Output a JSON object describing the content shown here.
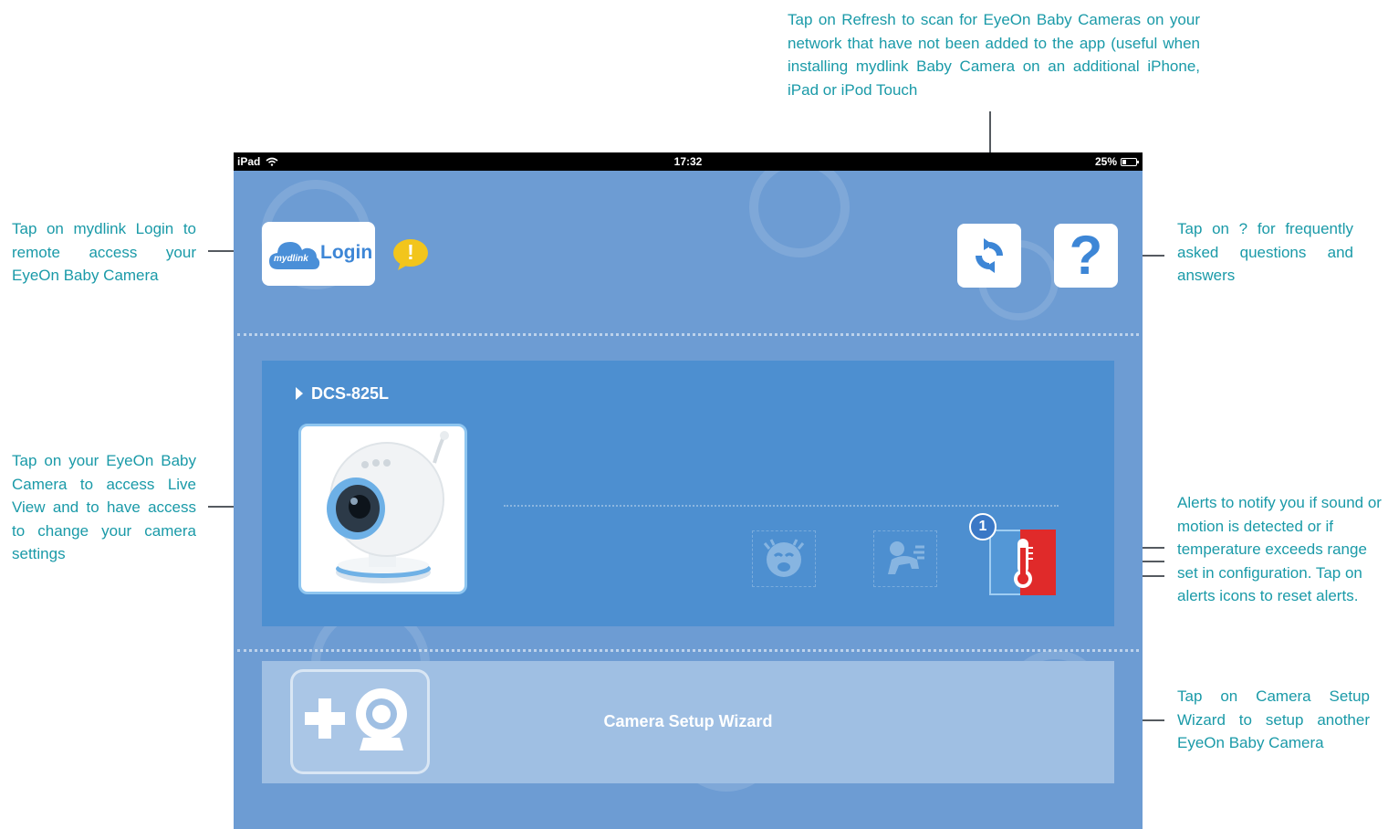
{
  "annotations": {
    "refresh": "Tap on Refresh to scan for EyeOn Baby Cameras on your network that have not been added to the app (useful when installing mydlink Baby Camera on an additional iPhone, iPad or iPod Touch",
    "login": "Tap on mydlink Login to remote access your EyeOn Baby Camera",
    "help": "Tap on ? for frequently asked questions and answers",
    "camera": "Tap on your EyeOn Baby Camera to access Live View and to have access to change your camera settings",
    "alerts": "Alerts to notify you if sound or motion is detected or if temperature exceeds range set in configuration. Tap on alerts icons to reset alerts.",
    "wizard": "Tap on Camera Setup Wizard to setup another EyeOn Baby Camera"
  },
  "status_bar": {
    "device": "iPad",
    "time": "17:32",
    "battery": "25%"
  },
  "header": {
    "login_label": "Login",
    "mydlink_label": "mydlink",
    "warning_mark": "!",
    "help_mark": "?"
  },
  "camera": {
    "name": "DCS-825L",
    "alert_count": "1"
  },
  "wizard": {
    "label": "Camera Setup Wizard"
  },
  "colors": {
    "annotation_text": "#1a9aa8",
    "screen_bg": "#6d9cd3",
    "camera_panel": "#4d8fd0",
    "wizard_panel": "#9fbfe3",
    "alert_red": "#e02a2a",
    "warning_yellow": "#f2c51c"
  }
}
